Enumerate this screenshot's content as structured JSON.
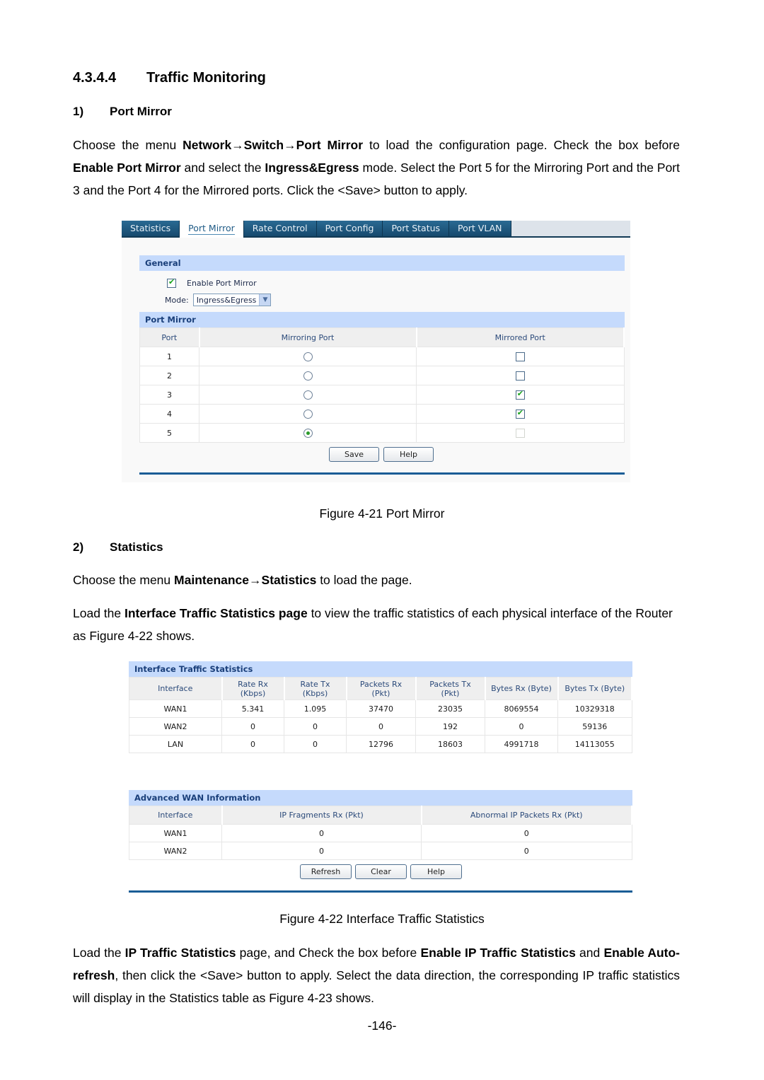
{
  "section": {
    "number": "4.3.4.4",
    "title": "Traffic Monitoring"
  },
  "port_mirror_section": {
    "number": "1)",
    "title": "Port Mirror",
    "paragraph": {
      "t1": "Choose the menu ",
      "b1": "Network→Switch→Port Mirror",
      "t2": " to load the configuration page. Check the box before ",
      "b2": "Enable Port Mirror",
      "t3": " and select the ",
      "b3": "Ingress&Egress",
      "t4": " mode. Select the Port 5 for the Mirroring Port and the Port 3 and the Port 4 for the Mirrored ports. Click the <Save> button to apply."
    }
  },
  "figure1": {
    "tabs": [
      "Statistics",
      "Port Mirror",
      "Rate Control",
      "Port Config",
      "Port Status",
      "Port VLAN"
    ],
    "active_tab": "Port Mirror",
    "general": {
      "title": "General",
      "enable_label": "Enable Port Mirror",
      "enable_checked": true,
      "mode_label": "Mode:",
      "mode_value": "Ingress&Egress"
    },
    "port_mirror": {
      "title": "Port Mirror",
      "columns": [
        "Port",
        "Mirroring Port",
        "Mirrored Port"
      ],
      "rows": [
        {
          "port": "1",
          "mirroring": false,
          "mirrored": false
        },
        {
          "port": "2",
          "mirroring": false,
          "mirrored": false
        },
        {
          "port": "3",
          "mirroring": false,
          "mirrored": true
        },
        {
          "port": "4",
          "mirroring": false,
          "mirrored": true
        },
        {
          "port": "5",
          "mirroring": true,
          "mirrored": false,
          "mirrored_disabled": true
        }
      ]
    },
    "buttons": {
      "save": "Save",
      "help": "Help"
    },
    "caption": "Figure 4-21 Port Mirror"
  },
  "statistics_section": {
    "number": "2)",
    "title": "Statistics",
    "para1": {
      "t1": "Choose the menu ",
      "b1": "Maintenance→Statistics",
      "t2": " to load the page."
    },
    "para2": {
      "t1": "Load the ",
      "b1": "Interface Traffic Statistics page",
      "t2": " to view the traffic statistics of each physical interface of the Router as Figure 4-22 shows."
    }
  },
  "figure2": {
    "interface_stats": {
      "title": "Interface Traffic Statistics",
      "columns": [
        [
          "Interface",
          ""
        ],
        [
          "Rate Rx",
          "(Kbps)"
        ],
        [
          "Rate Tx",
          "(Kbps)"
        ],
        [
          "Packets Rx",
          "(Pkt)"
        ],
        [
          "Packets Tx",
          "(Pkt)"
        ],
        [
          "Bytes Rx (Byte)",
          ""
        ],
        [
          "Bytes Tx (Byte)",
          ""
        ]
      ],
      "rows": [
        [
          "WAN1",
          "5.341",
          "1.095",
          "37470",
          "23035",
          "8069554",
          "10329318"
        ],
        [
          "WAN2",
          "0",
          "0",
          "0",
          "192",
          "0",
          "59136"
        ],
        [
          "LAN",
          "0",
          "0",
          "12796",
          "18603",
          "4991718",
          "14113055"
        ]
      ]
    },
    "advanced_wan": {
      "title": "Advanced WAN Information",
      "columns": [
        "Interface",
        "IP Fragments Rx (Pkt)",
        "Abnormal IP Packets Rx (Pkt)"
      ],
      "rows": [
        [
          "WAN1",
          "0",
          "0"
        ],
        [
          "WAN2",
          "0",
          "0"
        ]
      ]
    },
    "buttons": {
      "refresh": "Refresh",
      "clear": "Clear",
      "help": "Help"
    },
    "caption": "Figure 4-22 Interface Traffic Statistics"
  },
  "closing_paragraph": {
    "t1": "Load the ",
    "b1": "IP Traffic Statistics",
    "t2": " page, and Check the box before ",
    "b2": "Enable IP Traffic Statistics",
    "t3": " and ",
    "b3": "Enable Auto-refresh",
    "t4": ", then click the <Save> button to apply. Select the data direction, the corresponding IP traffic statistics will display in the Statistics table as Figure 4-23 shows."
  },
  "page_number": "-146-",
  "colors": {
    "tab_bg": "#1f5b86",
    "section_header_bg": "#c5dafc",
    "check_green": "#19a31c",
    "rule_blue": "#1a5d96"
  }
}
